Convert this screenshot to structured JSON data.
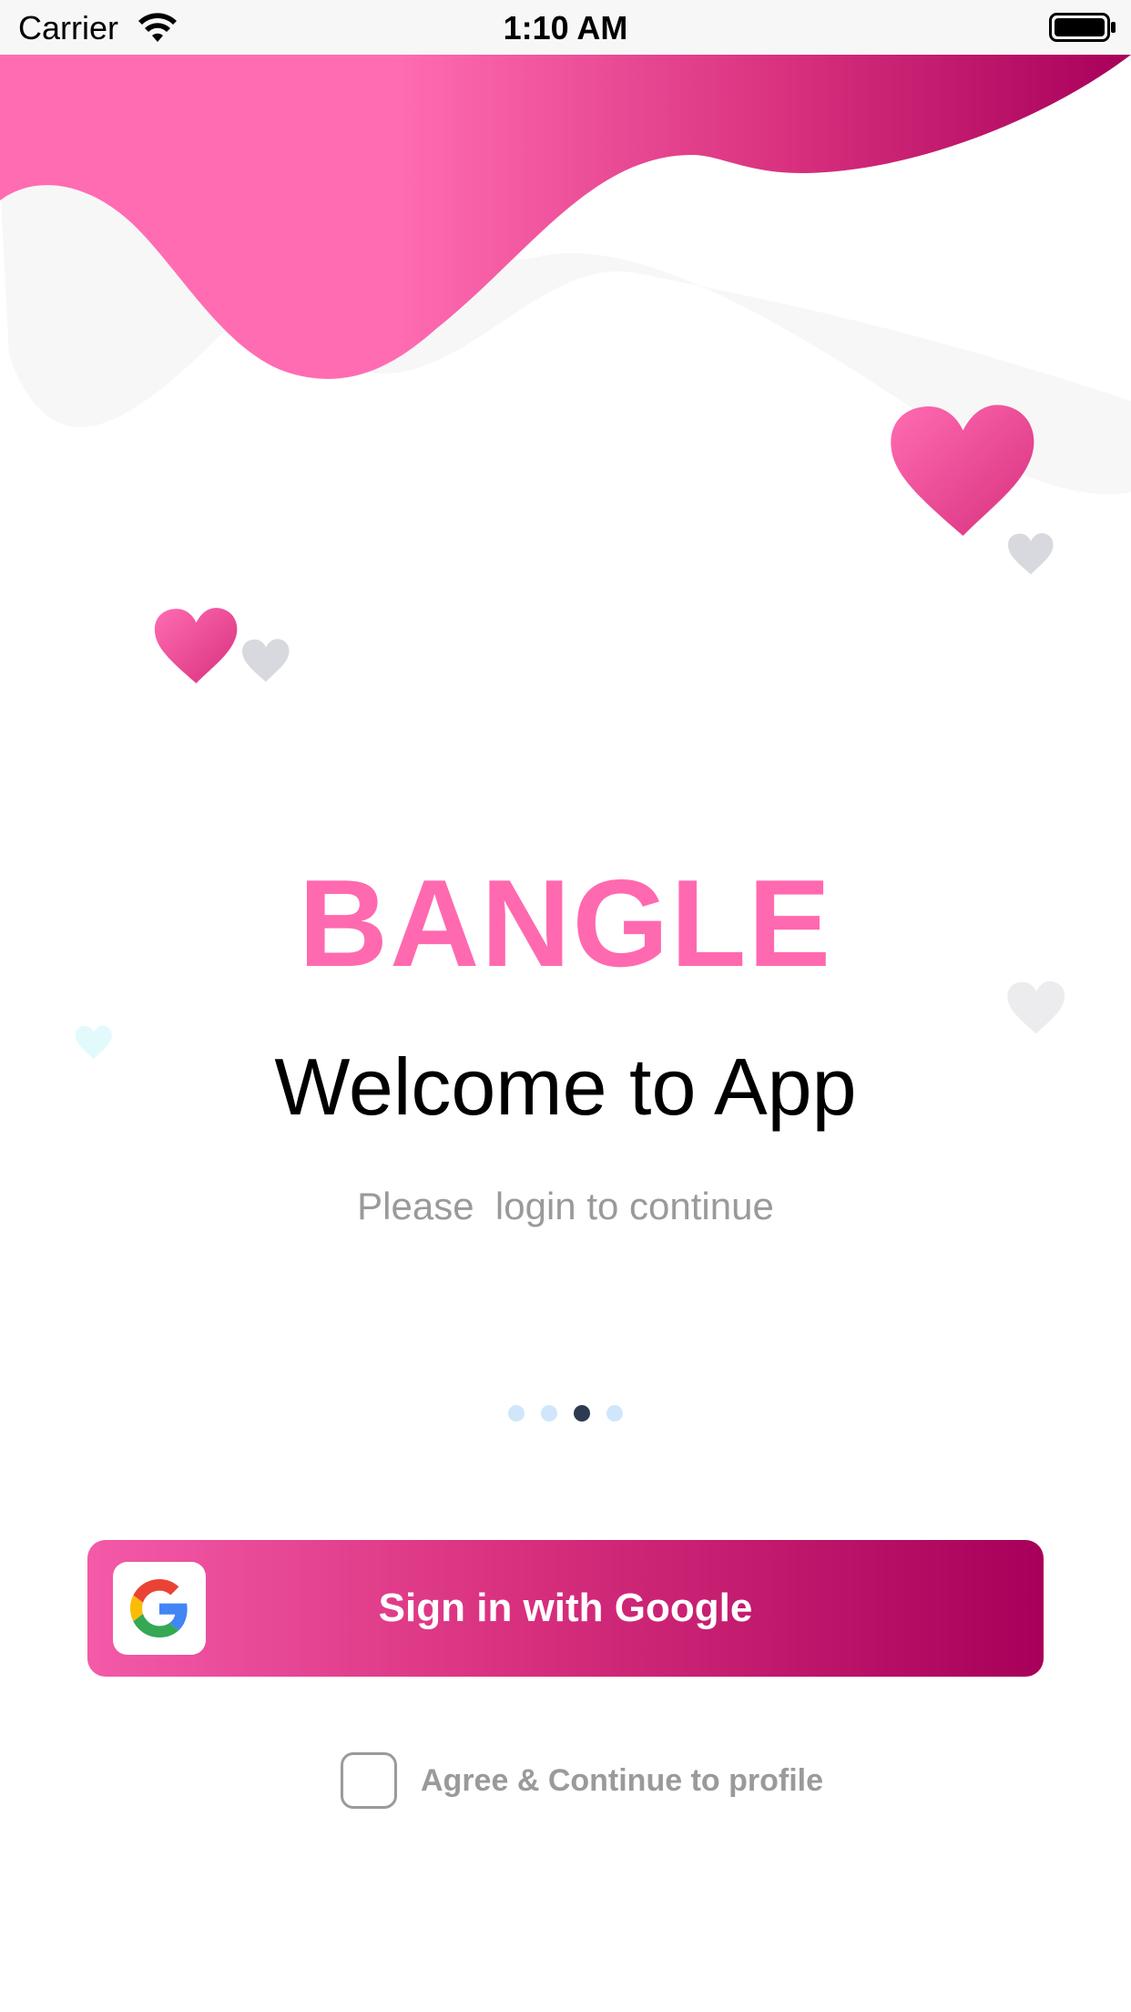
{
  "status_bar": {
    "carrier": "Carrier",
    "time": "1:10 AM",
    "icons": [
      "wifi-icon",
      "battery-icon"
    ]
  },
  "brand": {
    "name": "BANGLE",
    "color": "#ff69b0"
  },
  "welcome": {
    "title": "Welcome to App",
    "subtitle": "Please  login to continue"
  },
  "pager": {
    "count": 4,
    "active_index": 2
  },
  "google_button": {
    "label": "Sign in with Google",
    "icon": "google-icon"
  },
  "agree": {
    "label": "Agree & Continue to profile",
    "checked": false
  },
  "colors": {
    "accent_pink": "#ff69b0",
    "gradient_end": "#a8005a",
    "muted_text": "#9a9a9a",
    "dot_inactive": "#cfe6fb",
    "dot_active": "#2d3a52"
  }
}
